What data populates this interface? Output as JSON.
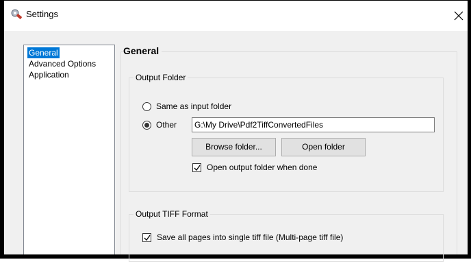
{
  "window": {
    "title": "Settings",
    "app_icon": "settings-wrench-icon",
    "close_icon": "close-icon"
  },
  "nav": {
    "items": [
      {
        "label": "General",
        "selected": true
      },
      {
        "label": "Advanced Options",
        "selected": false
      },
      {
        "label": "Application",
        "selected": false
      }
    ]
  },
  "page": {
    "title": "General",
    "output_folder": {
      "group_title": "Output Folder",
      "same_as_input_label": "Same as input folder",
      "same_as_input_selected": false,
      "other_label": "Other",
      "other_selected": true,
      "path_value": "G:\\My Drive\\Pdf2TiffConvertedFiles",
      "browse_label": "Browse folder...",
      "open_label": "Open folder",
      "open_when_done_label": "Open output folder when done",
      "open_when_done_checked": true
    },
    "output_tiff": {
      "group_title": "Output TIFF Format",
      "save_single_label": "Save all pages into single tiff file (Multi-page tiff file)",
      "save_single_checked": true
    }
  },
  "colors": {
    "selection": "#0078d7",
    "dialog_bg": "#f0f0f0",
    "button_bg": "#e1e1e1"
  }
}
